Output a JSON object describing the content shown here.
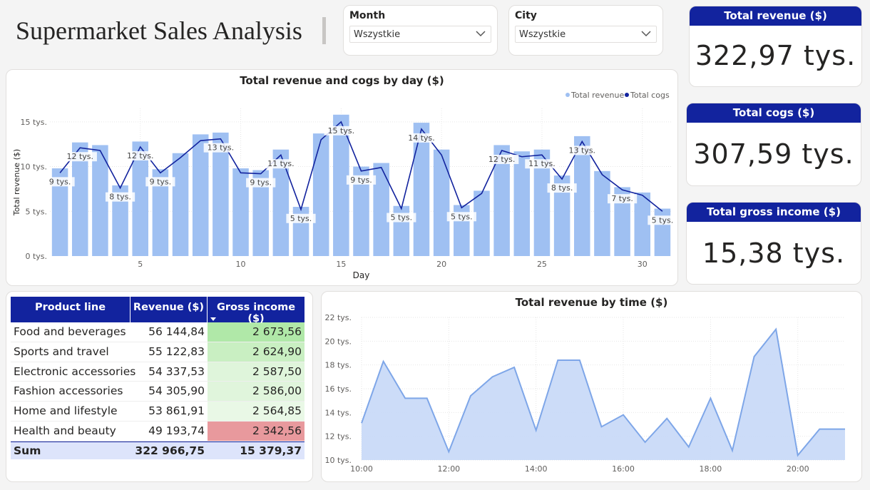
{
  "page": {
    "title": "Supermarket Sales Analysis"
  },
  "slicers": [
    {
      "label": "Month",
      "value": "Wszystkie"
    },
    {
      "label": "City",
      "value": "Wszystkie"
    }
  ],
  "kpis": [
    {
      "title": "Total revenue ($)",
      "value": "322,97 tys."
    },
    {
      "title": "Total cogs ($)",
      "value": "307,59 tys."
    },
    {
      "title": "Total gross income ($)",
      "value": "15,38 tys."
    }
  ],
  "colors": {
    "header": "#12239e",
    "bar": "#9fc0f2",
    "line": "#12239e",
    "area": "#c9daf8",
    "area_line": "#7ea6e8",
    "green_dark": "#b0e8a8",
    "green_mid": "#c9efc2",
    "green_light": "#def5da",
    "green_pale": "#e8f8e4",
    "red": "#e8999d"
  },
  "chart_data": [
    {
      "type": "bar",
      "title": "Total revenue and cogs by day ($)",
      "xlabel": "Day",
      "ylabel": "Total revenue ($)",
      "ylim": [
        0,
        16500
      ],
      "yticks": [
        {
          "v": 0,
          "label": "0 tys."
        },
        {
          "v": 5000,
          "label": "5 tys."
        },
        {
          "v": 10000,
          "label": "10 tys."
        },
        {
          "v": 15000,
          "label": "15 tys."
        }
      ],
      "xticks": [
        5,
        10,
        15,
        20,
        25,
        30
      ],
      "legend": [
        "Total revenue",
        "Total cogs"
      ],
      "legend_position": "top-right",
      "grid": true,
      "x": [
        1,
        2,
        3,
        4,
        5,
        6,
        7,
        8,
        9,
        10,
        11,
        12,
        13,
        14,
        15,
        16,
        17,
        18,
        19,
        20,
        21,
        22,
        23,
        24,
        25,
        26,
        27,
        28,
        29,
        30,
        31
      ],
      "series": [
        {
          "name": "Total revenue",
          "type": "bar",
          "values": [
            9800,
            12700,
            12400,
            7900,
            12800,
            9700,
            11500,
            13600,
            13800,
            9800,
            9600,
            11900,
            5500,
            13700,
            15800,
            10000,
            10400,
            5600,
            14900,
            11900,
            5700,
            7300,
            12400,
            11700,
            11900,
            9000,
            13400,
            9500,
            7700,
            7100,
            5300
          ]
        },
        {
          "name": "Total cogs",
          "type": "line",
          "values": [
            9300,
            12100,
            11800,
            7600,
            12200,
            9300,
            11000,
            12900,
            13100,
            9300,
            9200,
            11300,
            5200,
            13000,
            15000,
            9500,
            9900,
            5300,
            14200,
            11300,
            5400,
            7000,
            11800,
            11100,
            11300,
            8600,
            12800,
            9100,
            7400,
            6800,
            5000
          ]
        }
      ],
      "data_labels": [
        {
          "x": 1,
          "label": "9 tys."
        },
        {
          "x": 2,
          "label": "12 tys."
        },
        {
          "x": 4,
          "label": "8 tys."
        },
        {
          "x": 5,
          "label": "12 tys."
        },
        {
          "x": 6,
          "label": "9 tys."
        },
        {
          "x": 9,
          "label": "13 tys."
        },
        {
          "x": 11,
          "label": "9 tys."
        },
        {
          "x": 12,
          "label": "11 tys."
        },
        {
          "x": 13,
          "label": "5 tys."
        },
        {
          "x": 15,
          "label": "15 tys."
        },
        {
          "x": 16,
          "label": "9 tys."
        },
        {
          "x": 18,
          "label": "5 tys."
        },
        {
          "x": 19,
          "label": "14 tys."
        },
        {
          "x": 21,
          "label": "5 tys."
        },
        {
          "x": 23,
          "label": "12 tys."
        },
        {
          "x": 25,
          "label": "11 tys."
        },
        {
          "x": 26,
          "label": "8 tys."
        },
        {
          "x": 27,
          "label": "13 tys."
        },
        {
          "x": 29,
          "label": "7 tys."
        },
        {
          "x": 31,
          "label": "5 tys."
        }
      ]
    },
    {
      "type": "area",
      "title": "Total revenue by time ($)",
      "ylim": [
        10000,
        22000
      ],
      "yticks": [
        {
          "v": 10000,
          "label": "10 tys."
        },
        {
          "v": 12000,
          "label": "12 tys."
        },
        {
          "v": 14000,
          "label": "14 tys."
        },
        {
          "v": 16000,
          "label": "16 tys."
        },
        {
          "v": 18000,
          "label": "18 tys."
        },
        {
          "v": 20000,
          "label": "20 tys."
        },
        {
          "v": 22000,
          "label": "22 tys."
        }
      ],
      "xlim": [
        600,
        1265
      ],
      "xticks": [
        {
          "v": 600,
          "label": "10:00"
        },
        {
          "v": 720,
          "label": "12:00"
        },
        {
          "v": 840,
          "label": "14:00"
        },
        {
          "v": 960,
          "label": "16:00"
        },
        {
          "v": 1080,
          "label": "18:00"
        },
        {
          "v": 1200,
          "label": "20:00"
        }
      ],
      "grid": true,
      "x": [
        600,
        630,
        660,
        690,
        720,
        750,
        780,
        810,
        840,
        870,
        900,
        930,
        960,
        990,
        1020,
        1050,
        1080,
        1110,
        1140,
        1170,
        1200,
        1230,
        1265
      ],
      "values": [
        13100,
        18300,
        15200,
        15200,
        10700,
        15400,
        17000,
        17800,
        12500,
        18400,
        18400,
        12800,
        13800,
        11500,
        13500,
        11100,
        15200,
        10800,
        18700,
        21000,
        10400,
        12600,
        12600
      ]
    }
  ],
  "product_table": {
    "headers": [
      "Product line",
      "Revenue ($)",
      "Gross income ($)"
    ],
    "rows": [
      {
        "product": "Food and beverages",
        "revenue": "56 144,84",
        "gross": "2 673,56",
        "bg": "#b0e8a8"
      },
      {
        "product": "Sports and travel",
        "revenue": "55 122,83",
        "gross": "2 624,90",
        "bg": "#c9efc2"
      },
      {
        "product": "Electronic accessories",
        "revenue": "54 337,53",
        "gross": "2 587,50",
        "bg": "#dff5db"
      },
      {
        "product": "Fashion accessories",
        "revenue": "54 305,90",
        "gross": "2 586,00",
        "bg": "#e0f5dc"
      },
      {
        "product": "Home and lifestyle",
        "revenue": "53 861,91",
        "gross": "2 564,85",
        "bg": "#e9f8e6"
      },
      {
        "product": "Health and beauty",
        "revenue": "49 193,74",
        "gross": "2 342,56",
        "bg": "#e8999d"
      }
    ],
    "sum": {
      "label": "Sum",
      "revenue": "322 966,75",
      "gross": "15 379,37"
    }
  }
}
